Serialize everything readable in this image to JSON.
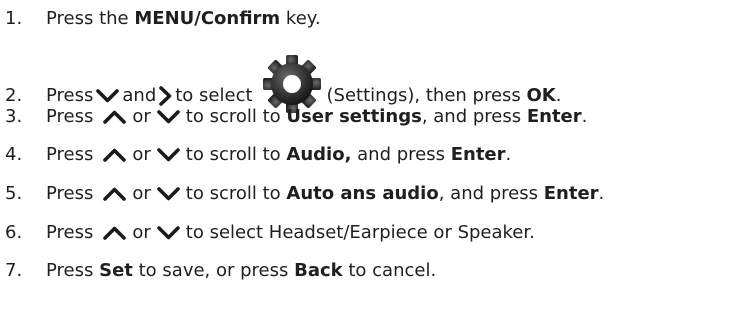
{
  "steps": [
    {
      "num": "1.",
      "a": "Press the ",
      "b": "MENU/Confirm",
      "c": " key."
    },
    {
      "num": "2.",
      "a": "Press",
      "b": "and",
      "c": "to select",
      "d": "(Settings), then press ",
      "e": "OK",
      "f": "."
    },
    {
      "num": "3.",
      "a": "Press",
      "b": "or",
      "c": "to scroll to ",
      "d": "User settings",
      "e": ", and press ",
      "f": "Enter",
      "g": "."
    },
    {
      "num": "4.",
      "a": "Press",
      "b": "or",
      "c": "to scroll to ",
      "d": "Audio,",
      "e": " and press ",
      "f": "Enter",
      "g": "."
    },
    {
      "num": "5.",
      "a": "Press",
      "b": "or",
      "c": "to scroll to ",
      "d": "Auto ans audio",
      "e": ", and press ",
      "f": "Enter",
      "g": "."
    },
    {
      "num": "6.",
      "a": "Press",
      "b": "or",
      "c": "to select Headset/Earpiece or Speaker."
    },
    {
      "num": "7.",
      "a": "Press ",
      "b": "Set",
      "c": " to save, or press ",
      "d": "Back",
      "e": " to cancel."
    }
  ],
  "icons": {
    "down": "chevron-down-icon",
    "right": "chevron-right-icon",
    "up": "chevron-up-icon",
    "gear": "gear-icon"
  },
  "colors": {
    "text": "#1f1f1f",
    "icon": "#1a1a1a"
  }
}
